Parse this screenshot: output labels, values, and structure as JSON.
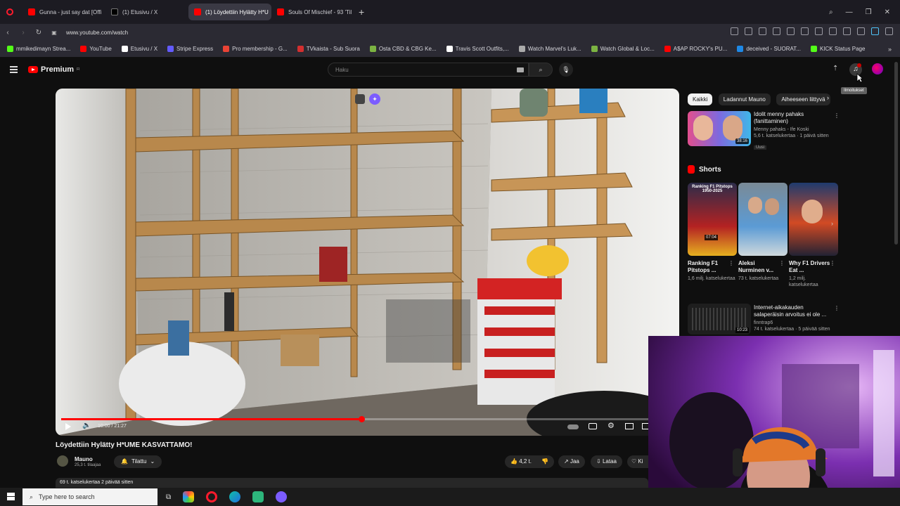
{
  "browser": {
    "tabs": [
      {
        "label": "Gunna - just say dat [Offi",
        "color": "#ff0000",
        "active": false
      },
      {
        "label": "(1) Etusivu / X",
        "color": "#ffffff",
        "active": false
      },
      {
        "label": "(1) Löydettiin Hylätty H*U",
        "color": "#ff0000",
        "active": true
      },
      {
        "label": "Souls Of Mischief - 93 'Til",
        "color": "#ff0000",
        "active": false
      }
    ],
    "url": "www.youtube.com/watch",
    "bookmarks": [
      {
        "label": "mmikedimayn Strea...",
        "color": "#53fc18"
      },
      {
        "label": "YouTube",
        "color": "#ff0000"
      },
      {
        "label": "Etusivu / X",
        "color": "#ffffff"
      },
      {
        "label": "Stripe Express",
        "color": "#635bff"
      },
      {
        "label": "Pro membership - G...",
        "color": "#ea4335"
      },
      {
        "label": "TVkaista - Sub Suora",
        "color": "#d32f2f"
      },
      {
        "label": "Osta CBD & CBG Ke...",
        "color": "#7cb342"
      },
      {
        "label": "Travis Scott Outfits,...",
        "color": "#ffffff"
      },
      {
        "label": "Watch Marvel's Luk...",
        "color": "#aaaaaa"
      },
      {
        "label": "Watch Global & Loc...",
        "color": "#7cb342"
      },
      {
        "label": "A$AP ROCKY's PU...",
        "color": "#ff0000"
      },
      {
        "label": "deceived - SUORAT...",
        "color": "#1e88e5"
      },
      {
        "label": "KICK Status Page",
        "color": "#53fc18"
      }
    ]
  },
  "youtube": {
    "logo_text": "Premium",
    "logo_sup": "FI",
    "search_placeholder": "Haku",
    "tooltip": "Ilmoitukset",
    "video": {
      "time": "10:00 / 21:27",
      "progress": 0.49,
      "title": "Löydettiin Hylätty H*UME KASVATTAMO!",
      "channel": "Mauno",
      "subs": "25,3 t. tilaajaa",
      "subscribe_label": "Tilattu",
      "likes": "4,2 t.",
      "share": "Jaa",
      "download": "Lataa",
      "thanks": "Ki",
      "views": "69 t. katselukertaa  2 päivää sitten"
    },
    "chips": [
      "Kaikki",
      "Ladannut Mauno",
      "Aiheeseen liittyvä"
    ],
    "rec1": {
      "title": "Idolit menny pahaks (fanittaminen)",
      "channel": "Menny pahaks - Ife Koski",
      "meta": "5,6 t. katselukertaa · 1 päivä sitten",
      "badge": "Uusi",
      "duration": "38:16"
    },
    "shorts_header": "Shorts",
    "shorts": [
      {
        "title": "Ranking F1 Pitstops ...",
        "views": "1,6 milj. katselukertaa",
        "overlay": "Ranking F1 Pitstops 1950-2025",
        "duration": "07:04"
      },
      {
        "title": "Aleksi Nurminen v...",
        "views": "73 t. katselukertaa",
        "overlay": "",
        "duration": ""
      },
      {
        "title": "Why F1 Drivers Eat ...",
        "views": "1,2 milj. katselukertaa",
        "overlay": "",
        "duration": ""
      }
    ],
    "rec2": {
      "title": "Internet-aikakauden salaperäisin arvoitus ei ole ...",
      "channel": "finntrap6",
      "meta": "74 t. katselukertaa · 5 päivää sitten",
      "duration": "10:23"
    }
  },
  "taskbar": {
    "search_placeholder": "Type here to search"
  }
}
